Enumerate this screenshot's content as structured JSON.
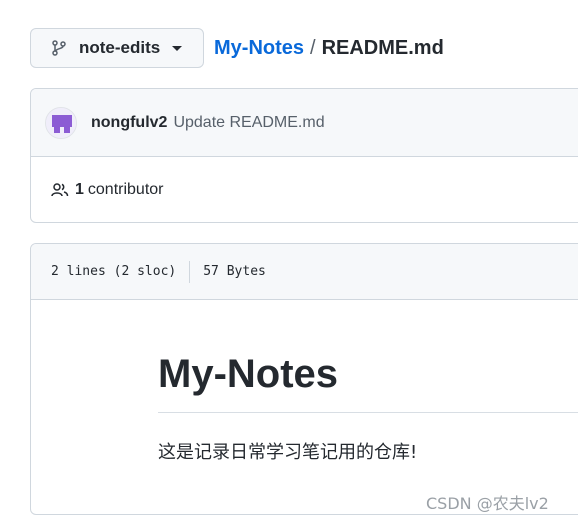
{
  "branch": {
    "label": "note-edits"
  },
  "breadcrumb": {
    "repo": "My-Notes",
    "separator": "/",
    "file": "README.md"
  },
  "commit": {
    "author": "nongfulv2",
    "message": "Update README.md"
  },
  "contributors": {
    "count": "1",
    "label": "contributor"
  },
  "file_info": {
    "lines": "2 lines (2 sloc)",
    "size": "57 Bytes"
  },
  "readme": {
    "heading": "My-Notes",
    "body": "这是记录日常学习笔记用的仓库!"
  },
  "watermark": "CSDN @农夫lv2",
  "colors": {
    "link": "#0969da",
    "header_bg": "#f6f8fa",
    "border": "#d0d7de",
    "avatar": "#8c5cd4"
  }
}
